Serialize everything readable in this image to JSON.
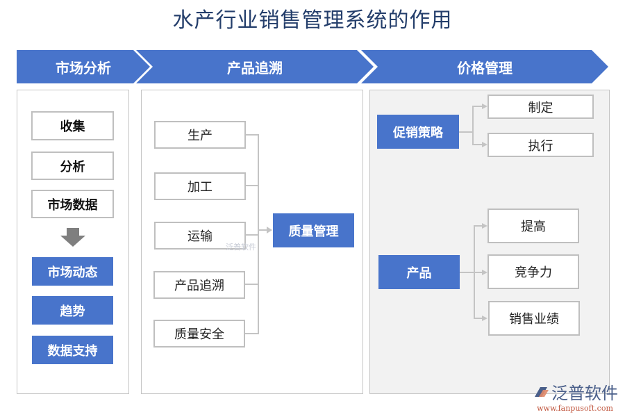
{
  "title": "水产行业销售管理系统的作用",
  "headers": [
    "市场分析",
    "产品追溯",
    "价格管理"
  ],
  "market_analysis": {
    "inputs": [
      "收集",
      "分析",
      "市场数据"
    ],
    "arrow_icon": "down-arrow-icon",
    "outputs": [
      "市场动态",
      "趋势",
      "数据支持"
    ]
  },
  "traceability": {
    "sources": [
      "生产",
      "加工",
      "运输",
      "产品追溯",
      "质量安全"
    ],
    "target": "质量管理"
  },
  "pricing": {
    "groups": [
      {
        "name": "促销策略",
        "children": [
          "制定",
          "执行"
        ]
      },
      {
        "name": "产品",
        "children": [
          "提高",
          "竞争力",
          "销售业绩"
        ]
      }
    ]
  },
  "watermark": "泛普软件",
  "logo": {
    "name": "泛普软件",
    "url": "www.fanpusoft.com"
  },
  "colors": {
    "accent": "#4874cb",
    "title": "#243e6b",
    "border": "#bfbfbf",
    "panel_grey": "#f2f2f2",
    "logo_orange": "#c0563e"
  }
}
